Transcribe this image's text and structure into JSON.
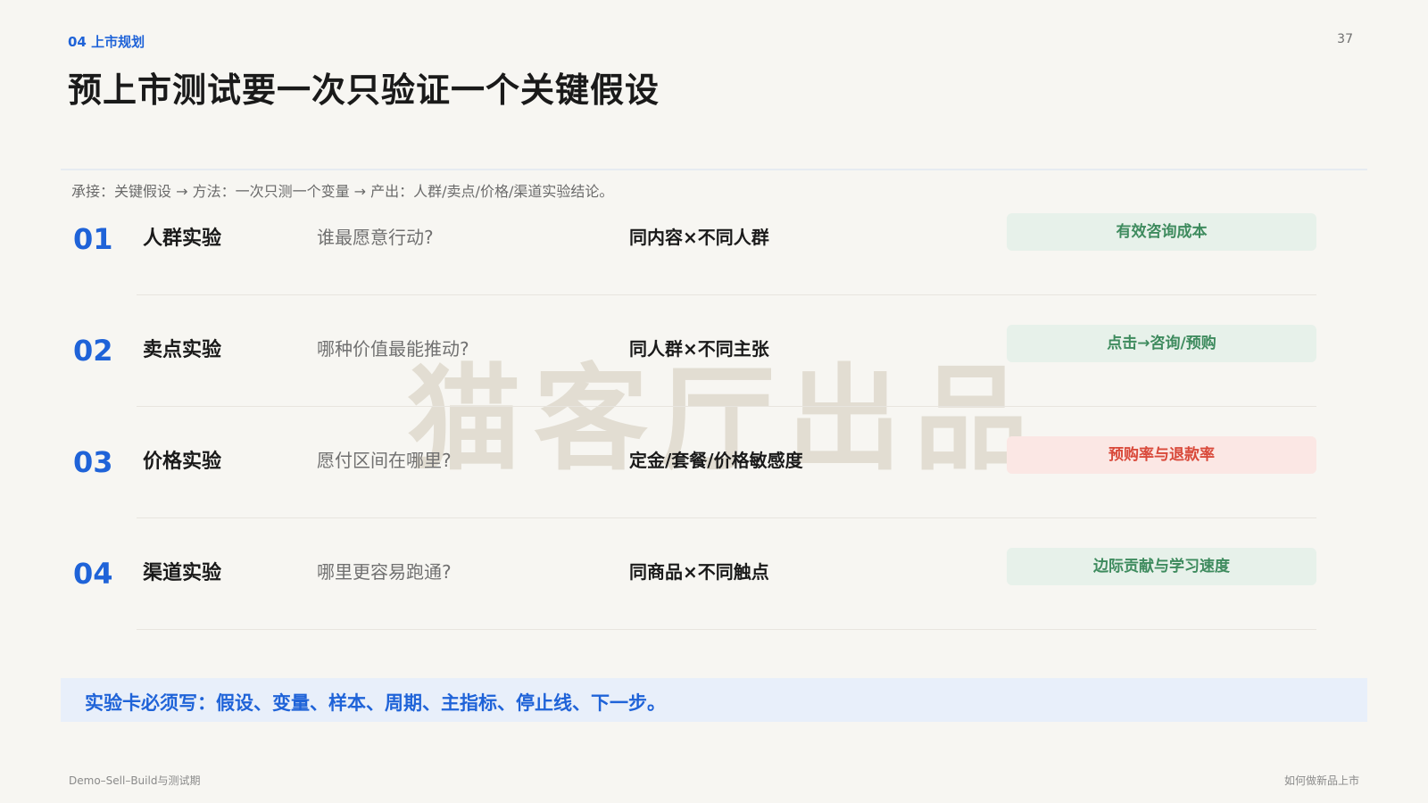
{
  "header": {
    "section_tag": "04 上市规划",
    "page_number": "37",
    "title": "预上市测试要一次只验证一个关键假设"
  },
  "flow_line": "承接：关键假设 → 方法：一次只测一个变量 → 产出：人群/卖点/价格/渠道实验结论。",
  "watermark": "猫客厅出品",
  "experiments": [
    {
      "num": "01",
      "name": "人群实验",
      "question": "谁最愿意行动?",
      "method": "同内容×不同人群",
      "metric": "有效咨询成本"
    },
    {
      "num": "02",
      "name": "卖点实验",
      "question": "哪种价值最能推动?",
      "method": "同人群×不同主张",
      "metric": "点击→咨询/预购"
    },
    {
      "num": "03",
      "name": "价格实验",
      "question": "愿付区间在哪里?",
      "method": "定金/套餐/价格敏感度",
      "metric": "预购率与退款率"
    },
    {
      "num": "04",
      "name": "渠道实验",
      "question": "哪里更容易跑通?",
      "method": "同商品×不同触点",
      "metric": "边际贡献与学习速度"
    }
  ],
  "callout": "实验卡必须写：假设、变量、样本、周期、主指标、停止线、下一步。",
  "footer": {
    "left": "Demo–Sell–Build与测试期",
    "right": "如何做新品上市"
  },
  "colors": {
    "accent": "#1f63d8",
    "metric_green_bg": "#e7f1ea",
    "metric_green_text": "#3e8b5e",
    "metric_red_bg": "#fbe7e4",
    "metric_red_text": "#d9493a",
    "callout_bg": "#e8effa"
  }
}
